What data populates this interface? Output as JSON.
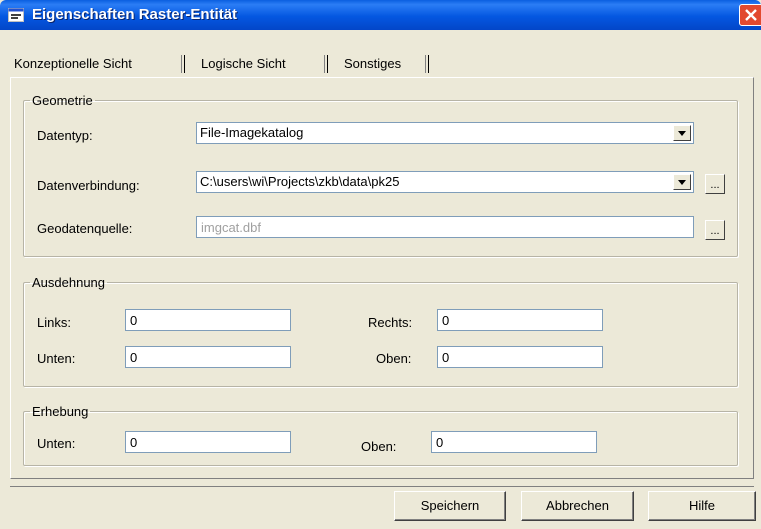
{
  "window": {
    "title": "Eigenschaften Raster-Entität"
  },
  "tabs": [
    "Konzeptionelle Sicht",
    "Logische Sicht",
    "Sonstiges"
  ],
  "geometrie": {
    "legend": "Geometrie",
    "datentyp_label": "Datentyp:",
    "datentyp_value": "File-Imagekatalog",
    "datenverbindung_label": "Datenverbindung:",
    "datenverbindung_value": "C:\\users\\wi\\Projects\\zkb\\data\\pk25",
    "geodatenquelle_label": "Geodatenquelle:",
    "geodatenquelle_value": "imgcat.dbf",
    "browse_label": "..."
  },
  "ausdehnung": {
    "legend": "Ausdehnung",
    "links_label": "Links:",
    "links_value": "0",
    "rechts_label": "Rechts:",
    "rechts_value": "0",
    "unten_label": "Unten:",
    "unten_value": "0",
    "oben_label": "Oben:",
    "oben_value": "0"
  },
  "erhebung": {
    "legend": "Erhebung",
    "unten_label": "Unten:",
    "unten_value": "0",
    "oben_label": "Oben:",
    "oben_value": "0"
  },
  "buttons": {
    "save": "Speichern",
    "cancel": "Abbrechen",
    "help": "Hilfe"
  },
  "colors": {
    "titlebar": "#0457e1",
    "dialog": "#ece9d8",
    "close": "#e2492f"
  }
}
